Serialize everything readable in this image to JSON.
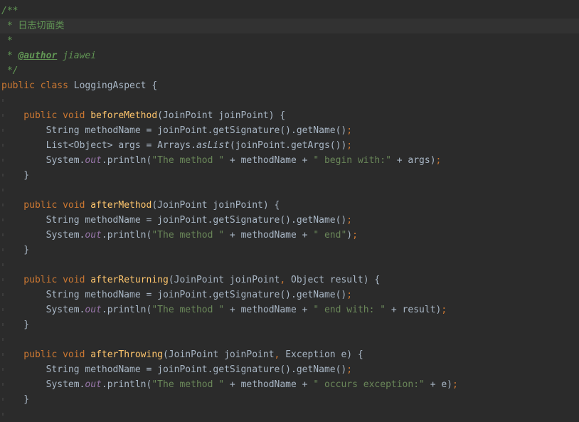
{
  "editor": {
    "language": "java",
    "colors": {
      "background": "#2b2b2b",
      "current_line": "#323232",
      "default": "#a9b7c6",
      "keyword": "#cc7832",
      "method_declaration": "#ffc66d",
      "string": "#6a8759",
      "static_field": "#9876aa",
      "doc_comment": "#629755"
    },
    "lines": [
      {
        "tokens": [
          {
            "t": "/**",
            "c": "doc"
          }
        ]
      },
      {
        "current": true,
        "tokens": [
          {
            "t": " * ",
            "c": "doc"
          },
          {
            "t": "日志切面类",
            "c": "doc cjk"
          }
        ]
      },
      {
        "tokens": [
          {
            "t": " *",
            "c": "doc"
          }
        ]
      },
      {
        "tokens": [
          {
            "t": " * ",
            "c": "doc"
          },
          {
            "t": "@author",
            "c": "tag"
          },
          {
            "t": " jiawei",
            "c": "doc"
          }
        ]
      },
      {
        "tokens": [
          {
            "t": " */",
            "c": "doc"
          }
        ]
      },
      {
        "tokens": [
          {
            "t": "public class ",
            "c": "kw"
          },
          {
            "t": "LoggingAspect {",
            "c": ""
          }
        ]
      },
      {
        "guide": true,
        "tokens": []
      },
      {
        "guide": true,
        "tokens": [
          {
            "t": "    public void ",
            "c": "kw"
          },
          {
            "t": "beforeMethod",
            "c": "fn"
          },
          {
            "t": "(JoinPoint joinPoint) {",
            "c": ""
          }
        ]
      },
      {
        "guide": true,
        "tokens": [
          {
            "t": "        String methodName = joinPoint.getSignature().getName()",
            "c": ""
          },
          {
            "t": ";",
            "c": "kw"
          }
        ]
      },
      {
        "guide": true,
        "tokens": [
          {
            "t": "        List<Object> args = Arrays.",
            "c": ""
          },
          {
            "t": "asList",
            "c": "smethod"
          },
          {
            "t": "(joinPoint.getArgs())",
            "c": ""
          },
          {
            "t": ";",
            "c": "kw"
          }
        ]
      },
      {
        "guide": true,
        "tokens": [
          {
            "t": "        System.",
            "c": ""
          },
          {
            "t": "out",
            "c": "static"
          },
          {
            "t": ".println(",
            "c": ""
          },
          {
            "t": "\"The method \"",
            "c": "str"
          },
          {
            "t": " + methodName + ",
            "c": ""
          },
          {
            "t": "\" begin with:\"",
            "c": "str"
          },
          {
            "t": " + args)",
            "c": ""
          },
          {
            "t": ";",
            "c": "kw"
          }
        ]
      },
      {
        "guide": true,
        "tokens": [
          {
            "t": "    }",
            "c": ""
          }
        ]
      },
      {
        "guide": true,
        "tokens": []
      },
      {
        "guide": true,
        "tokens": [
          {
            "t": "    public void ",
            "c": "kw"
          },
          {
            "t": "afterMethod",
            "c": "fn"
          },
          {
            "t": "(JoinPoint joinPoint) {",
            "c": ""
          }
        ]
      },
      {
        "guide": true,
        "tokens": [
          {
            "t": "        String methodName = joinPoint.getSignature().getName()",
            "c": ""
          },
          {
            "t": ";",
            "c": "kw"
          }
        ]
      },
      {
        "guide": true,
        "tokens": [
          {
            "t": "        System.",
            "c": ""
          },
          {
            "t": "out",
            "c": "static"
          },
          {
            "t": ".println(",
            "c": ""
          },
          {
            "t": "\"The method \"",
            "c": "str"
          },
          {
            "t": " + methodName + ",
            "c": ""
          },
          {
            "t": "\" end\"",
            "c": "str"
          },
          {
            "t": ")",
            "c": ""
          },
          {
            "t": ";",
            "c": "kw"
          }
        ]
      },
      {
        "guide": true,
        "tokens": [
          {
            "t": "    }",
            "c": ""
          }
        ]
      },
      {
        "guide": true,
        "tokens": []
      },
      {
        "guide": true,
        "tokens": [
          {
            "t": "    public void ",
            "c": "kw"
          },
          {
            "t": "afterReturning",
            "c": "fn"
          },
          {
            "t": "(JoinPoint joinPoint",
            "c": ""
          },
          {
            "t": ", ",
            "c": "kw"
          },
          {
            "t": "Object result) {",
            "c": ""
          }
        ]
      },
      {
        "guide": true,
        "tokens": [
          {
            "t": "        String methodName = joinPoint.getSignature().getName()",
            "c": ""
          },
          {
            "t": ";",
            "c": "kw"
          }
        ]
      },
      {
        "guide": true,
        "tokens": [
          {
            "t": "        System.",
            "c": ""
          },
          {
            "t": "out",
            "c": "static"
          },
          {
            "t": ".println(",
            "c": ""
          },
          {
            "t": "\"The method \"",
            "c": "str"
          },
          {
            "t": " + methodName + ",
            "c": ""
          },
          {
            "t": "\" end with: \"",
            "c": "str"
          },
          {
            "t": " + result)",
            "c": ""
          },
          {
            "t": ";",
            "c": "kw"
          }
        ]
      },
      {
        "guide": true,
        "tokens": [
          {
            "t": "    }",
            "c": ""
          }
        ]
      },
      {
        "guide": true,
        "tokens": []
      },
      {
        "guide": true,
        "tokens": [
          {
            "t": "    public void ",
            "c": "kw"
          },
          {
            "t": "afterThrowing",
            "c": "fn"
          },
          {
            "t": "(JoinPoint joinPoint",
            "c": ""
          },
          {
            "t": ", ",
            "c": "kw"
          },
          {
            "t": "Exception e) {",
            "c": ""
          }
        ]
      },
      {
        "guide": true,
        "tokens": [
          {
            "t": "        String methodName = joinPoint.getSignature().getName()",
            "c": ""
          },
          {
            "t": ";",
            "c": "kw"
          }
        ]
      },
      {
        "guide": true,
        "tokens": [
          {
            "t": "        System.",
            "c": ""
          },
          {
            "t": "out",
            "c": "static"
          },
          {
            "t": ".println(",
            "c": ""
          },
          {
            "t": "\"The method \"",
            "c": "str"
          },
          {
            "t": " + methodName + ",
            "c": ""
          },
          {
            "t": "\" occurs exception:\"",
            "c": "str"
          },
          {
            "t": " + e)",
            "c": ""
          },
          {
            "t": ";",
            "c": "kw"
          }
        ]
      },
      {
        "guide": true,
        "tokens": [
          {
            "t": "    }",
            "c": ""
          }
        ]
      },
      {
        "guide": true,
        "tokens": []
      }
    ]
  }
}
